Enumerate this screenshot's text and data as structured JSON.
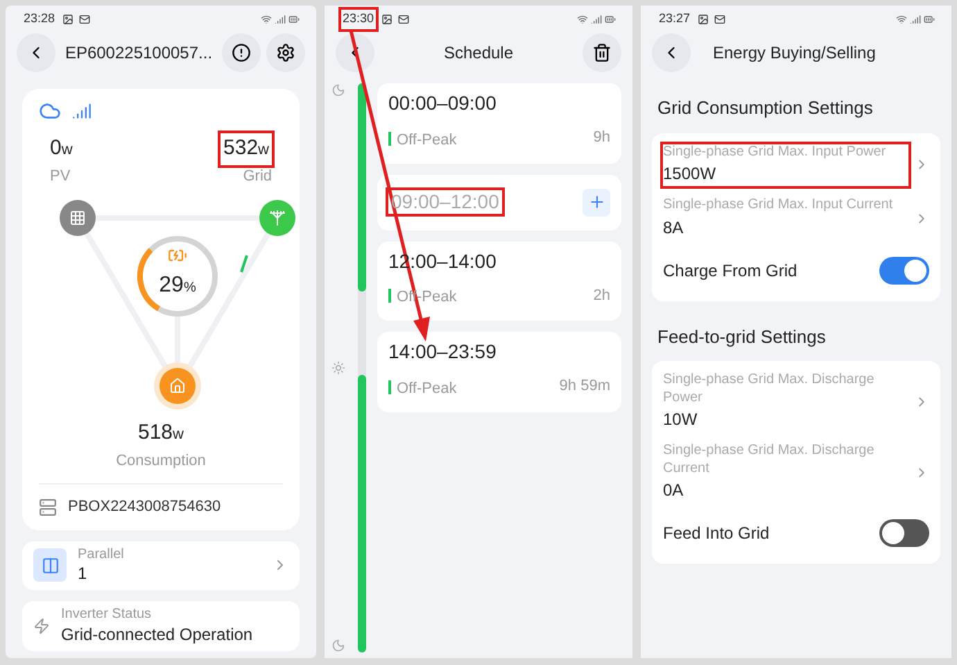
{
  "device_screen": {
    "status_bar": {
      "time": "23:28"
    },
    "title": "EP600225100057...",
    "flow": {
      "pv": {
        "value": "0",
        "unit": "w",
        "label": "PV"
      },
      "grid": {
        "value": "532",
        "unit": "w",
        "label": "Grid",
        "highlighted": true
      },
      "battery": {
        "percent": "29",
        "unit": "%",
        "level": 0.29
      },
      "consumption": {
        "value": "518",
        "unit": "w",
        "label": "Consumption"
      }
    },
    "serial": "PBOX2243008754630",
    "parallel": {
      "label": "Parallel",
      "value": "1"
    },
    "inverter_status": {
      "label": "Inverter Status",
      "value": "Grid-connected Operation"
    }
  },
  "schedule_screen": {
    "status_bar": {
      "time": "23:30",
      "highlighted": true
    },
    "title": "Schedule",
    "slots": [
      {
        "kind": "period",
        "time": "00:00–09:00",
        "tag": "Off-Peak",
        "duration": "9h",
        "highlighted": false
      },
      {
        "kind": "empty",
        "time": "09:00–12:00",
        "highlighted": true
      },
      {
        "kind": "period",
        "time": "12:00–14:00",
        "tag": "Off-Peak",
        "duration": "2h",
        "highlighted": false
      },
      {
        "kind": "period",
        "time": "14:00–23:59",
        "tag": "Off-Peak",
        "duration": "9h 59m",
        "highlighted": false
      }
    ]
  },
  "settings_screen": {
    "status_bar": {
      "time": "23:27"
    },
    "title": "Energy Buying/Selling",
    "sections": [
      {
        "title": "Grid Consumption Settings",
        "items": [
          {
            "kind": "value",
            "label": "Single-phase Grid Max. Input Power",
            "value": "1500W",
            "highlighted": true
          },
          {
            "kind": "value",
            "label": "Single-phase Grid Max. Input Current",
            "value": "8A",
            "highlighted": false
          },
          {
            "kind": "toggle",
            "label": "Charge From Grid",
            "on": true
          }
        ]
      },
      {
        "title": "Feed-to-grid Settings",
        "items": [
          {
            "kind": "value",
            "label": "Single-phase Grid Max. Discharge Power",
            "value": "10W",
            "highlighted": false
          },
          {
            "kind": "value",
            "label": "Single-phase Grid Max. Discharge Current",
            "value": "0A",
            "highlighted": false
          },
          {
            "kind": "toggle",
            "label": "Feed Into Grid",
            "on": false
          }
        ]
      }
    ]
  }
}
